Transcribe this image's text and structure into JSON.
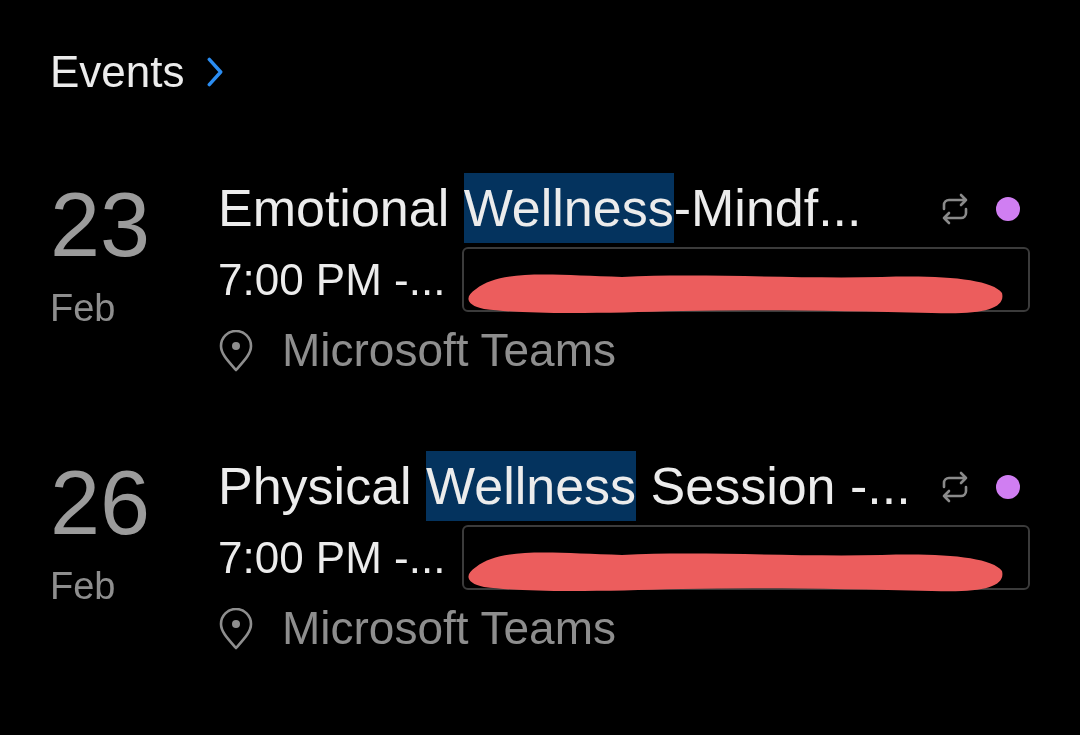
{
  "header": {
    "title": "Events"
  },
  "events": [
    {
      "day": "23",
      "month": "Feb",
      "title_parts": [
        {
          "text": "Emotional ",
          "highlighted": false
        },
        {
          "text": "Wellness",
          "highlighted": true
        },
        {
          "text": "-Mindf...",
          "highlighted": false
        }
      ],
      "recurring": true,
      "color": "#d07ef2",
      "time": "7:00 PM -...",
      "attendee_redacted": true,
      "location": "Microsoft Teams"
    },
    {
      "day": "26",
      "month": "Feb",
      "title_parts": [
        {
          "text": "Physical ",
          "highlighted": false
        },
        {
          "text": "Wellness",
          "highlighted": true
        },
        {
          "text": " Session -...",
          "highlighted": false
        }
      ],
      "recurring": true,
      "color": "#d07ef2",
      "time": "7:00 PM -...",
      "attendee_redacted": true,
      "location": "Microsoft Teams"
    }
  ]
}
